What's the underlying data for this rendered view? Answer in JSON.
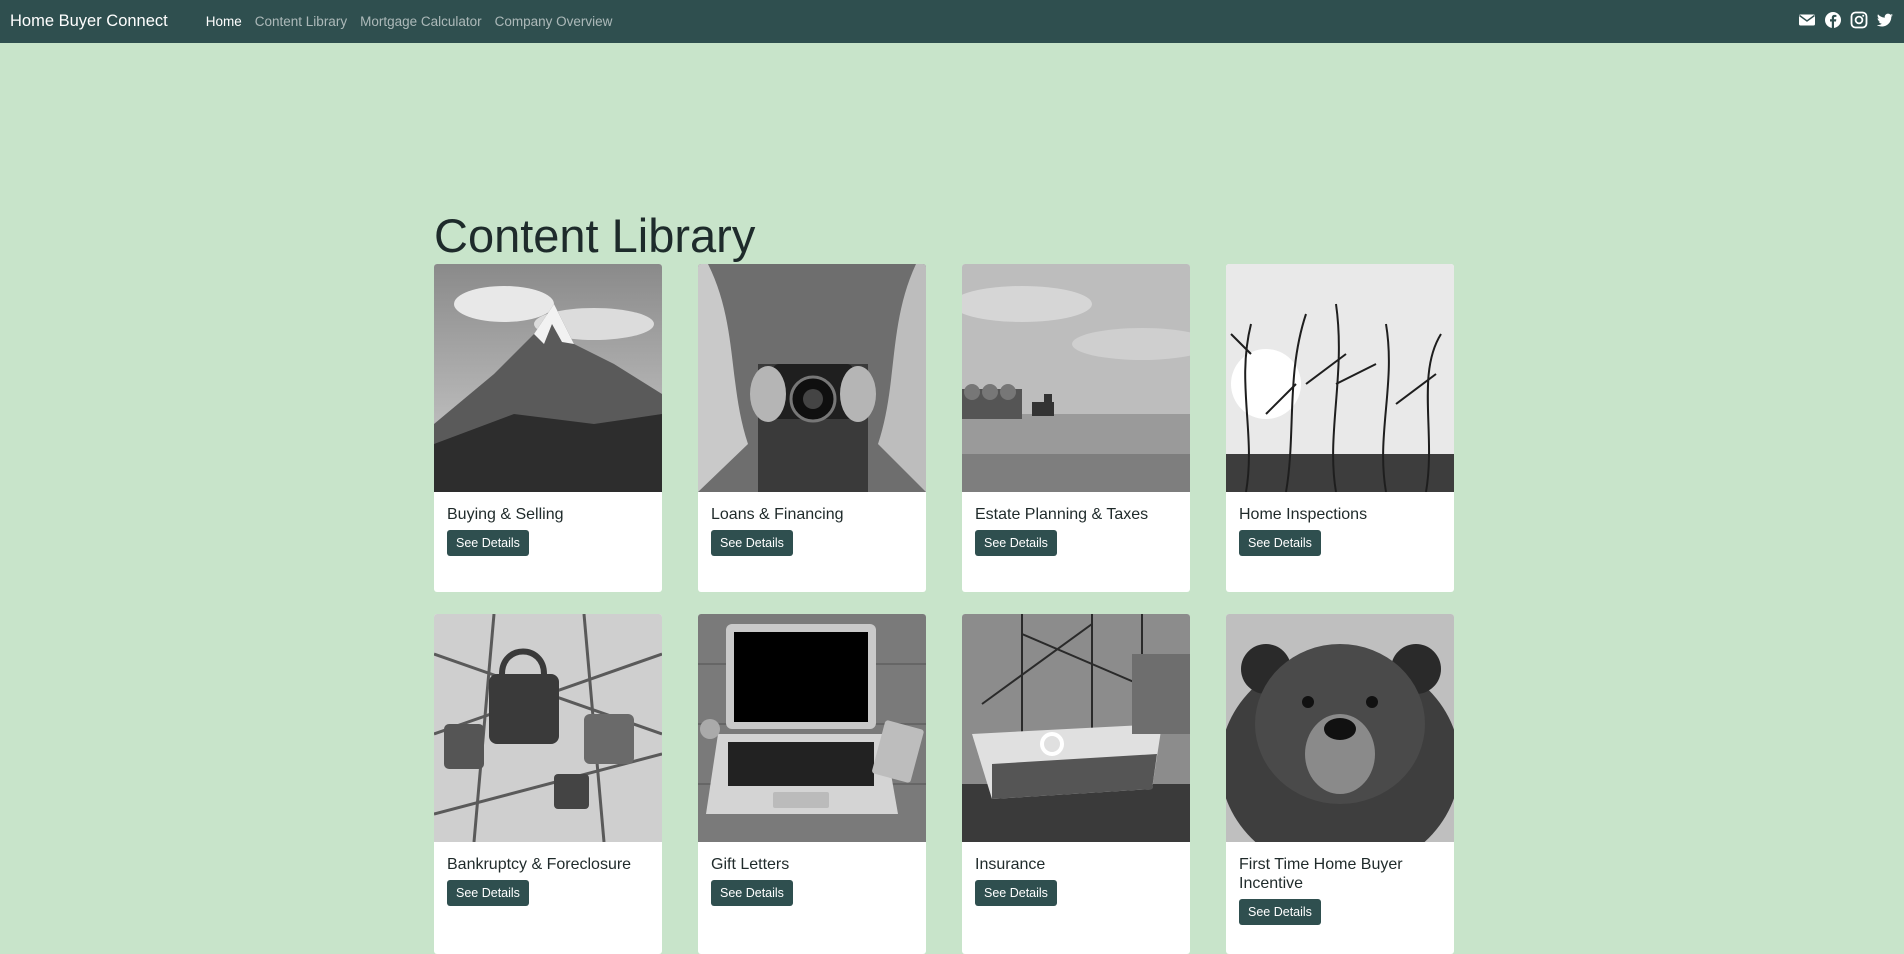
{
  "navbar": {
    "brand": "Home Buyer Connect",
    "links": [
      {
        "label": "Home",
        "active": true
      },
      {
        "label": "Content Library",
        "active": false
      },
      {
        "label": "Mortgage Calculator",
        "active": false
      },
      {
        "label": "Company Overview",
        "active": false
      }
    ],
    "social_icons": [
      "envelope-icon",
      "facebook-icon",
      "instagram-icon",
      "twitter-icon"
    ]
  },
  "main": {
    "title": "Content Library",
    "button_label": "See Details",
    "cards": [
      {
        "title": "Buying & Selling",
        "image": "mountain-photo"
      },
      {
        "title": "Loans & Financing",
        "image": "camera-photo"
      },
      {
        "title": "Estate Planning & Taxes",
        "image": "field-tractor-photo"
      },
      {
        "title": "Home Inspections",
        "image": "branches-photo"
      },
      {
        "title": "Bankruptcy & Foreclosure",
        "image": "padlocks-photo"
      },
      {
        "title": "Gift Letters",
        "image": "laptop-photo"
      },
      {
        "title": "Insurance",
        "image": "boat-photo"
      },
      {
        "title": "First Time Home Buyer Incentive",
        "image": "bear-photo"
      }
    ]
  },
  "colors": {
    "navbar": "#2f4f4f",
    "background": "#c8e4ca",
    "button": "#2f4f4f"
  }
}
